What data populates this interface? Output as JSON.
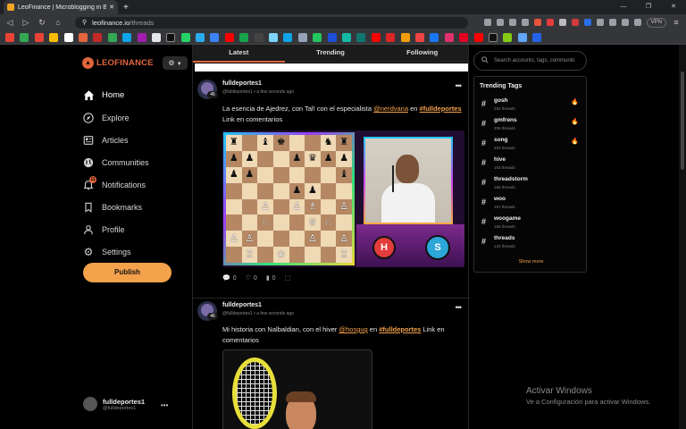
{
  "browser": {
    "tab_title": "LeoFinance | Microblogging in Bl",
    "tab_close": "✕",
    "new_tab": "+",
    "win_min": "—",
    "win_restore": "❐",
    "win_close": "✕",
    "url_host": "leofinance.io",
    "url_path": "/threads",
    "vpn_label": "VPN"
  },
  "sidebar": {
    "logo_text": "LEOFINANCE",
    "menu": [
      {
        "label": "Home",
        "icon": "home-icon"
      },
      {
        "label": "Explore",
        "icon": "compass-icon"
      },
      {
        "label": "Articles",
        "icon": "newspaper-icon"
      },
      {
        "label": "Communities",
        "icon": "globe-icon"
      },
      {
        "label": "Notifications",
        "icon": "bell-icon",
        "badge": "11"
      },
      {
        "label": "Bookmarks",
        "icon": "bookmark-icon"
      },
      {
        "label": "Profile",
        "icon": "user-icon"
      },
      {
        "label": "Settings",
        "icon": "gear-icon"
      }
    ],
    "publish_label": "Publish",
    "user_name": "fulldeportes1",
    "user_handle": "@fulldeportes1",
    "more": "•••"
  },
  "feed": {
    "tabs": [
      "Latest",
      "Trending",
      "Following"
    ],
    "posts": [
      {
        "author": "fulldeportes1",
        "handle": "@fulldeportes1",
        "time": "a few seconds ago",
        "rep": "46",
        "text_before": "La esencia de Ajedrez, con Tal! con el especialista ",
        "mention": "@nerdvana",
        "text_mid": " en ",
        "hashtag": "#fulldeportes",
        "text_after": " Link en comentarios",
        "coin_left": "H",
        "coin_right": "S",
        "comments": "0",
        "likes": "0",
        "views": "0"
      },
      {
        "author": "fulldeportes1",
        "handle": "@fulldeportes1",
        "time": "a few seconds ago",
        "rep": "46",
        "text_before": "Mi historia con Nalbaldian, con el hiver ",
        "mention": "@hosgug",
        "text_mid": " en ",
        "hashtag": "#fulldeportes",
        "text_after": " Link en comentarios"
      }
    ]
  },
  "search": {
    "placeholder": "Search accounts, tags, communiti"
  },
  "trending": {
    "title": "Trending Tags",
    "tags": [
      {
        "tag": "gosh",
        "count": "294 threads",
        "hot": true
      },
      {
        "tag": "gmfrens",
        "count": "206 threads",
        "hot": true
      },
      {
        "tag": "song",
        "count": "203 threads",
        "hot": true
      },
      {
        "tag": "hive",
        "count": "183 threads",
        "hot": false
      },
      {
        "tag": "threadstorm",
        "count": "166 threads",
        "hot": false
      },
      {
        "tag": "woo",
        "count": "157 threads",
        "hot": false
      },
      {
        "tag": "woogame",
        "count": "156 threads",
        "hot": false
      },
      {
        "tag": "threads",
        "count": "142 threads",
        "hot": false
      }
    ],
    "show_more": "Show more"
  },
  "windows_notice": {
    "line1": "Activar Windows",
    "line2": "Ve a Configuración para activar Windows."
  },
  "colors": {
    "accent": "#f3a14a",
    "brand": "#e2653c"
  }
}
